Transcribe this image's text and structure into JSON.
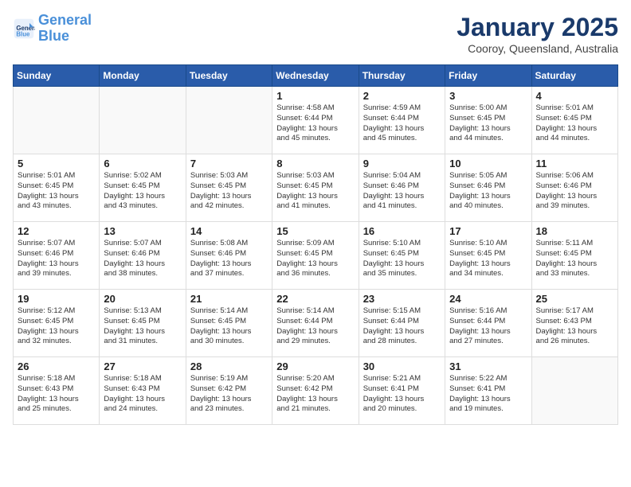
{
  "header": {
    "logo_line1": "General",
    "logo_line2": "Blue",
    "month": "January 2025",
    "location": "Cooroy, Queensland, Australia"
  },
  "weekdays": [
    "Sunday",
    "Monday",
    "Tuesday",
    "Wednesday",
    "Thursday",
    "Friday",
    "Saturday"
  ],
  "weeks": [
    [
      {
        "day": "",
        "info": ""
      },
      {
        "day": "",
        "info": ""
      },
      {
        "day": "",
        "info": ""
      },
      {
        "day": "1",
        "info": "Sunrise: 4:58 AM\nSunset: 6:44 PM\nDaylight: 13 hours\nand 45 minutes."
      },
      {
        "day": "2",
        "info": "Sunrise: 4:59 AM\nSunset: 6:44 PM\nDaylight: 13 hours\nand 45 minutes."
      },
      {
        "day": "3",
        "info": "Sunrise: 5:00 AM\nSunset: 6:45 PM\nDaylight: 13 hours\nand 44 minutes."
      },
      {
        "day": "4",
        "info": "Sunrise: 5:01 AM\nSunset: 6:45 PM\nDaylight: 13 hours\nand 44 minutes."
      }
    ],
    [
      {
        "day": "5",
        "info": "Sunrise: 5:01 AM\nSunset: 6:45 PM\nDaylight: 13 hours\nand 43 minutes."
      },
      {
        "day": "6",
        "info": "Sunrise: 5:02 AM\nSunset: 6:45 PM\nDaylight: 13 hours\nand 43 minutes."
      },
      {
        "day": "7",
        "info": "Sunrise: 5:03 AM\nSunset: 6:45 PM\nDaylight: 13 hours\nand 42 minutes."
      },
      {
        "day": "8",
        "info": "Sunrise: 5:03 AM\nSunset: 6:45 PM\nDaylight: 13 hours\nand 41 minutes."
      },
      {
        "day": "9",
        "info": "Sunrise: 5:04 AM\nSunset: 6:46 PM\nDaylight: 13 hours\nand 41 minutes."
      },
      {
        "day": "10",
        "info": "Sunrise: 5:05 AM\nSunset: 6:46 PM\nDaylight: 13 hours\nand 40 minutes."
      },
      {
        "day": "11",
        "info": "Sunrise: 5:06 AM\nSunset: 6:46 PM\nDaylight: 13 hours\nand 39 minutes."
      }
    ],
    [
      {
        "day": "12",
        "info": "Sunrise: 5:07 AM\nSunset: 6:46 PM\nDaylight: 13 hours\nand 39 minutes."
      },
      {
        "day": "13",
        "info": "Sunrise: 5:07 AM\nSunset: 6:46 PM\nDaylight: 13 hours\nand 38 minutes."
      },
      {
        "day": "14",
        "info": "Sunrise: 5:08 AM\nSunset: 6:46 PM\nDaylight: 13 hours\nand 37 minutes."
      },
      {
        "day": "15",
        "info": "Sunrise: 5:09 AM\nSunset: 6:45 PM\nDaylight: 13 hours\nand 36 minutes."
      },
      {
        "day": "16",
        "info": "Sunrise: 5:10 AM\nSunset: 6:45 PM\nDaylight: 13 hours\nand 35 minutes."
      },
      {
        "day": "17",
        "info": "Sunrise: 5:10 AM\nSunset: 6:45 PM\nDaylight: 13 hours\nand 34 minutes."
      },
      {
        "day": "18",
        "info": "Sunrise: 5:11 AM\nSunset: 6:45 PM\nDaylight: 13 hours\nand 33 minutes."
      }
    ],
    [
      {
        "day": "19",
        "info": "Sunrise: 5:12 AM\nSunset: 6:45 PM\nDaylight: 13 hours\nand 32 minutes."
      },
      {
        "day": "20",
        "info": "Sunrise: 5:13 AM\nSunset: 6:45 PM\nDaylight: 13 hours\nand 31 minutes."
      },
      {
        "day": "21",
        "info": "Sunrise: 5:14 AM\nSunset: 6:45 PM\nDaylight: 13 hours\nand 30 minutes."
      },
      {
        "day": "22",
        "info": "Sunrise: 5:14 AM\nSunset: 6:44 PM\nDaylight: 13 hours\nand 29 minutes."
      },
      {
        "day": "23",
        "info": "Sunrise: 5:15 AM\nSunset: 6:44 PM\nDaylight: 13 hours\nand 28 minutes."
      },
      {
        "day": "24",
        "info": "Sunrise: 5:16 AM\nSunset: 6:44 PM\nDaylight: 13 hours\nand 27 minutes."
      },
      {
        "day": "25",
        "info": "Sunrise: 5:17 AM\nSunset: 6:43 PM\nDaylight: 13 hours\nand 26 minutes."
      }
    ],
    [
      {
        "day": "26",
        "info": "Sunrise: 5:18 AM\nSunset: 6:43 PM\nDaylight: 13 hours\nand 25 minutes."
      },
      {
        "day": "27",
        "info": "Sunrise: 5:18 AM\nSunset: 6:43 PM\nDaylight: 13 hours\nand 24 minutes."
      },
      {
        "day": "28",
        "info": "Sunrise: 5:19 AM\nSunset: 6:42 PM\nDaylight: 13 hours\nand 23 minutes."
      },
      {
        "day": "29",
        "info": "Sunrise: 5:20 AM\nSunset: 6:42 PM\nDaylight: 13 hours\nand 21 minutes."
      },
      {
        "day": "30",
        "info": "Sunrise: 5:21 AM\nSunset: 6:41 PM\nDaylight: 13 hours\nand 20 minutes."
      },
      {
        "day": "31",
        "info": "Sunrise: 5:22 AM\nSunset: 6:41 PM\nDaylight: 13 hours\nand 19 minutes."
      },
      {
        "day": "",
        "info": ""
      }
    ]
  ]
}
